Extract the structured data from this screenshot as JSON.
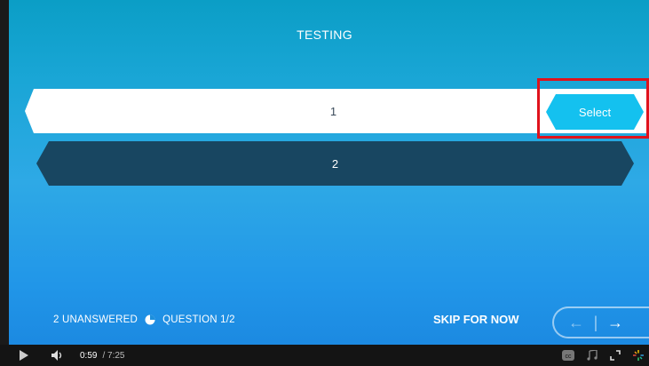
{
  "header": {
    "title": "TESTING"
  },
  "answers": [
    {
      "label": "1"
    },
    {
      "label": "2"
    }
  ],
  "select_button": {
    "label": "Select"
  },
  "status": {
    "unanswered": "2 UNANSWERED",
    "question": "QUESTION 1/2"
  },
  "skip": {
    "label": "SKIP FOR NOW"
  },
  "nav": {
    "prev": "←",
    "separator": "|",
    "next": "→"
  },
  "player": {
    "current_time": "0:59",
    "duration": "/ 7:25"
  },
  "colors": {
    "answer_dark": "#184661",
    "select_cyan": "#14c1ef",
    "highlight_red": "#e0121c"
  }
}
